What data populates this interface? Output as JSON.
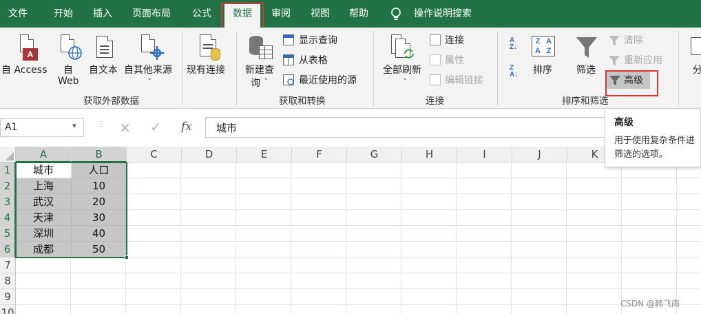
{
  "menu": {
    "tabs": [
      "文件",
      "开始",
      "插入",
      "页面布局",
      "公式",
      "数据",
      "审阅",
      "视图",
      "帮助"
    ],
    "active": "数据",
    "tell_me": "操作说明搜索"
  },
  "ribbon": {
    "get_external": {
      "label": "获取外部数据",
      "from_access": "自 Access",
      "from_web_1": "自",
      "from_web_2": "Web",
      "from_text": "自文本",
      "from_other": "自其他来源",
      "existing": "现有连接"
    },
    "get_transform": {
      "label": "获取和转换",
      "new_query_1": "新建查",
      "new_query_2": "询",
      "show_queries": "显示查询",
      "from_table": "从表格",
      "recent_sources": "最近使用的源"
    },
    "connections": {
      "label": "连接",
      "refresh_all": "全部刷新",
      "connections": "连接",
      "properties": "属性",
      "edit_links": "编辑链接"
    },
    "sort_filter": {
      "label": "排序和筛选",
      "sort": "排序",
      "filter": "筛选",
      "clear": "清除",
      "reapply": "重新应用",
      "advanced": "高级"
    },
    "more": "分"
  },
  "formula_bar": {
    "name_box": "A1",
    "fx": "fx",
    "content": "城市"
  },
  "sheet": {
    "columns": [
      "A",
      "B",
      "C",
      "D",
      "E",
      "F",
      "G",
      "H",
      "I",
      "J",
      "K"
    ],
    "rows": [
      "1",
      "2",
      "3",
      "4",
      "5",
      "6",
      "7",
      "8",
      "9",
      "10"
    ],
    "data": [
      [
        "城市",
        "人口"
      ],
      [
        "上海",
        "10"
      ],
      [
        "武汉",
        "20"
      ],
      [
        "天津",
        "30"
      ],
      [
        "深圳",
        "40"
      ],
      [
        "成都",
        "50"
      ]
    ]
  },
  "tooltip": {
    "title": "高级",
    "desc_1": "用于使用复杂条件进",
    "desc_2": "筛选的选项。"
  },
  "watermark": "CSDN @韩飞雨",
  "colors": {
    "accent": "#217346",
    "highlight": "#e03030"
  }
}
